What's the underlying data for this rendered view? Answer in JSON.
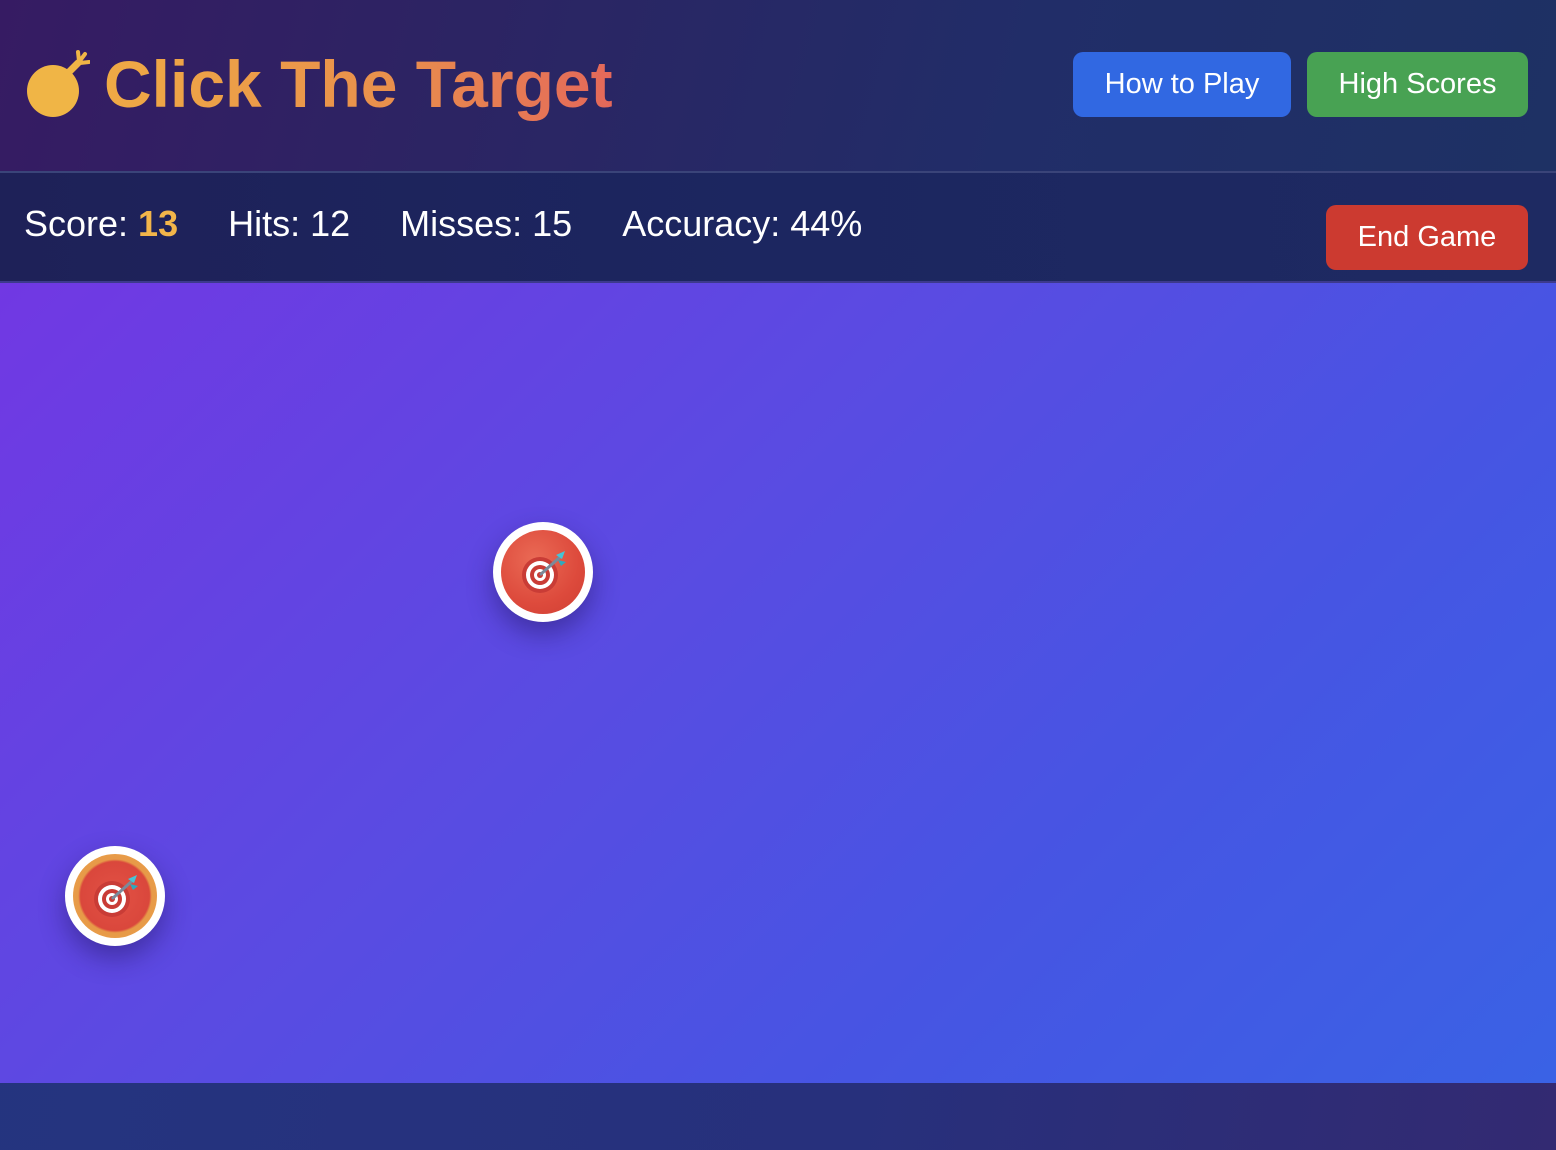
{
  "header": {
    "title": "Click The Target",
    "logo_icon": "bomb-icon",
    "buttons": {
      "how_to_play": "How to Play",
      "high_scores": "High Scores"
    }
  },
  "stats": {
    "score_label": "Score:",
    "score_value": "13",
    "hits_label": "Hits:",
    "hits_value": "12",
    "misses_label": "Misses:",
    "misses_value": "15",
    "accuracy_label": "Accuracy:",
    "accuracy_value": "44%"
  },
  "actions": {
    "end_game": "End Game"
  },
  "arena": {
    "targets": [
      {
        "icon": "direct-hit-dart-icon",
        "variant": "normal"
      },
      {
        "icon": "direct-hit-dart-icon",
        "variant": "bonus"
      }
    ]
  },
  "colors": {
    "title_gradient_start": "#efaa45",
    "title_gradient_end": "#e4685a",
    "how_to_play_button": "#3168e2",
    "high_scores_button": "#48a253",
    "end_game_button": "#cc3a30",
    "score_value": "#f2b54a",
    "target": "#dd4a3c",
    "bonus_ring": "#eaa24a"
  }
}
